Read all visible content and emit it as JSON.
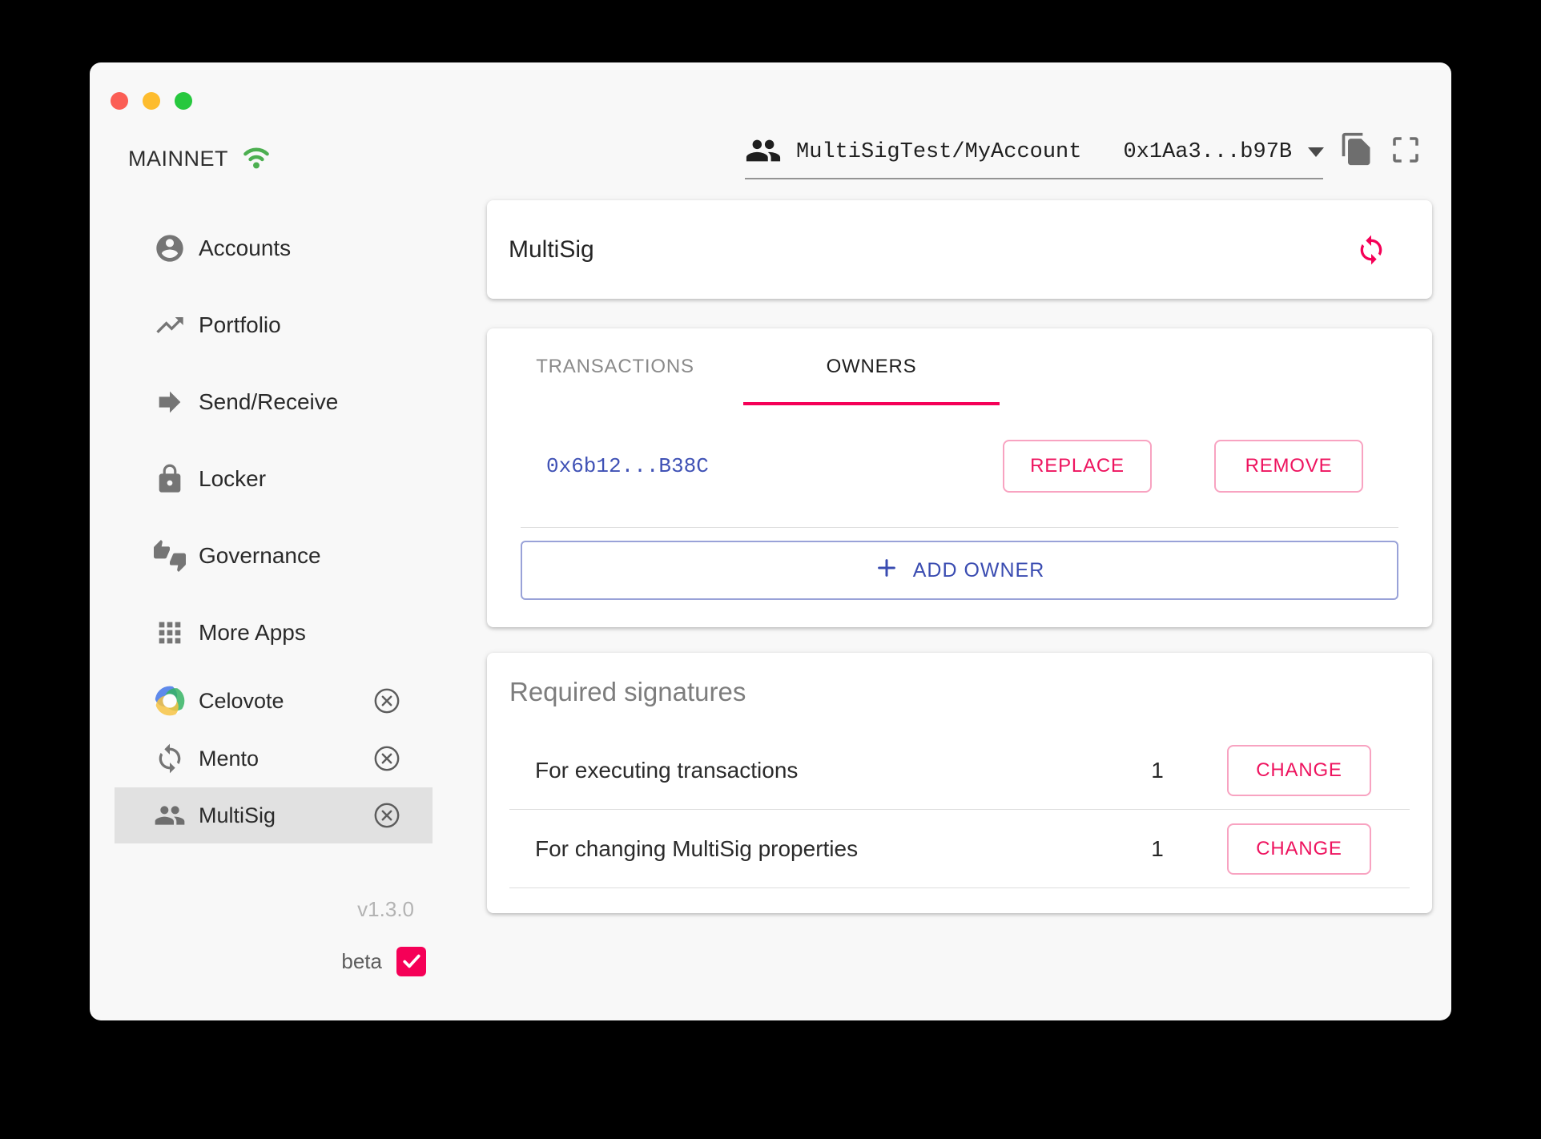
{
  "titlebar": {
    "network": "MAINNET"
  },
  "account_selector": {
    "name": "MultiSigTest/MyAccount",
    "address": "0x1Aa3...b97B"
  },
  "sidebar": {
    "items": [
      {
        "label": "Accounts",
        "icon": "account-circle-icon"
      },
      {
        "label": "Portfolio",
        "icon": "trending-up-icon"
      },
      {
        "label": "Send/Receive",
        "icon": "arrow-forward-icon"
      },
      {
        "label": "Locker",
        "icon": "lock-icon"
      },
      {
        "label": "Governance",
        "icon": "thumbs-up-down-icon"
      },
      {
        "label": "More Apps",
        "icon": "apps-grid-icon"
      }
    ],
    "apps": [
      {
        "label": "Celovote",
        "icon": "celovote-logo",
        "selected": false
      },
      {
        "label": "Mento",
        "icon": "sync-icon",
        "selected": false
      },
      {
        "label": "MultiSig",
        "icon": "people-icon",
        "selected": true
      }
    ],
    "version": "v1.3.0",
    "beta_label": "beta",
    "beta_checked": true
  },
  "main": {
    "title": "MultiSig",
    "tabs": [
      {
        "label": "TRANSACTIONS",
        "active": false
      },
      {
        "label": "OWNERS",
        "active": true
      }
    ],
    "owner": {
      "address": "0x6b12...B38C",
      "replace_label": "REPLACE",
      "remove_label": "REMOVE"
    },
    "add_owner_label": "ADD OWNER",
    "required_signatures": {
      "title": "Required signatures",
      "rows": [
        {
          "label": "For executing transactions",
          "value": "1",
          "action_label": "CHANGE"
        },
        {
          "label": "For changing MultiSig properties",
          "value": "1",
          "action_label": "CHANGE"
        }
      ]
    }
  },
  "colors": {
    "accent_pink": "#f50057",
    "accent_indigo": "#3f51b5",
    "wifi_green": "#4caf50",
    "selected_item_bg": "#e1e1e1",
    "traffic_red": "#fb5e55",
    "traffic_yellow": "#fdbc2e",
    "traffic_green": "#27c83e"
  }
}
